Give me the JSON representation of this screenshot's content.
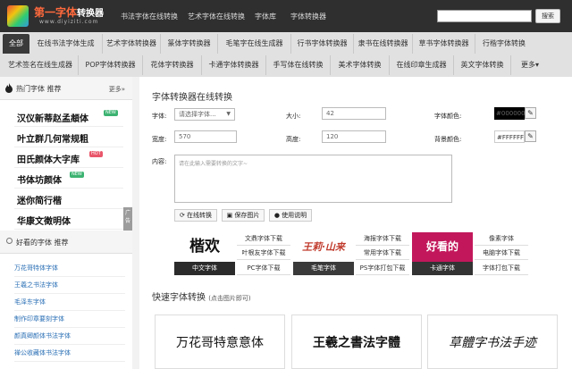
{
  "site": {
    "name": "第一字体",
    "name_suffix": "转换器",
    "url": "www.diyiziti.com"
  },
  "topnav": [
    "书法字体在线转换",
    "艺术字体在线转换",
    "字体库",
    "字体转换器"
  ],
  "search": {
    "placeholder": "",
    "button": "搜索"
  },
  "categories_row1": [
    "全部",
    "在线书法字体生成",
    "艺术字体转换器",
    "篆体字转换器",
    "毛笔字在线生成器",
    "行书字体转换器",
    "隶书在线转换器",
    "草书字体转换器",
    "行楷字体转换"
  ],
  "categories_row2": [
    "艺术签名在线生成器",
    "POP字体转换器",
    "花体字转换器",
    "卡通字体转换器",
    "手写体在线转换",
    "美术字体转换",
    "在线印章生成器",
    "英文字体转换",
    "更多▾"
  ],
  "sidebar": {
    "hot_title": "热门字体 推荐",
    "more": "更多»",
    "hot_items": [
      {
        "text": "汉仪新蒂赵孟頫体",
        "badge": "NEW"
      },
      {
        "text": "叶立群几何常规粗",
        "badge": ""
      },
      {
        "text": "田氏颜体大字库",
        "badge": "HOT"
      },
      {
        "text": "书体坊颜体",
        "badge": "NEW"
      },
      {
        "text": "迷你简行楷",
        "badge": ""
      },
      {
        "text": "华康文徵明体",
        "badge": ""
      }
    ],
    "ad_label": "广告",
    "good_title": "好看的字体 推荐",
    "good_items": [
      "万花哥特体字体",
      "王羲之书法字体",
      "毛泽东字体",
      "制作印章要刻字体",
      "颜真卿颜体书法字体",
      "禅公收藏体书法字体"
    ]
  },
  "main": {
    "title": "字体转换器在线转换",
    "font_label": "字体:",
    "font_select": "请选择字体...",
    "size_label": "大小:",
    "size_value": "42",
    "color_label": "字体颜色:",
    "color_value": "#000000",
    "width_label": "宽度:",
    "width_value": "570",
    "height_label": "高度:",
    "height_value": "120",
    "bg_label": "背景颜色:",
    "bg_value": "#FFFFFF",
    "content_label": "内容:",
    "content_placeholder": "请在此输入需要转换的文字~",
    "actions": [
      "在线转换",
      "保存图片",
      "使用说明"
    ]
  },
  "tiles": [
    {
      "art": "楷欢",
      "bar": "中文字体",
      "bar_color": "#2b2b2b",
      "links": [
        "文鼎字体下载",
        "叶根友字体下载",
        "PC字体下载"
      ]
    },
    {
      "art": "王莉·山来",
      "bar": "毛笔字体",
      "bar_color": "#3a3a3a",
      "links": [
        "海报字体下载",
        "常用字体下载",
        "PS字体打包下载"
      ]
    },
    {
      "art": "好看的",
      "bar": "卡通字体",
      "bar_color": "#333333",
      "links": [
        "像素字体",
        "电脑字体下载",
        "字体打包下载"
      ]
    }
  ],
  "quick": {
    "title": "快速字体转换",
    "subtitle": "(点击图片即可)",
    "previews": [
      "万花哥特意意体",
      "王羲之書法字體",
      "草體字书法手迹"
    ]
  }
}
